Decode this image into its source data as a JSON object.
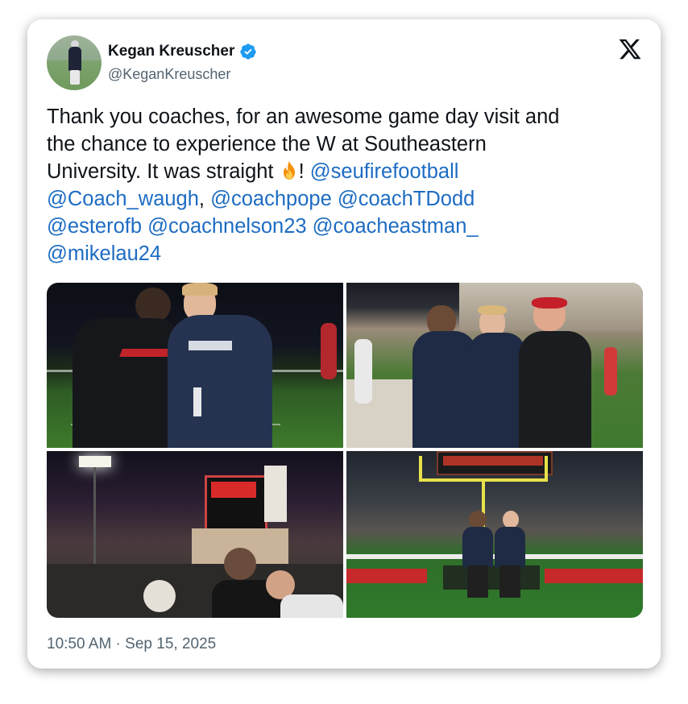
{
  "author": {
    "display_name": "Kegan Kreuscher",
    "handle": "@KeganKreuscher",
    "verified": true
  },
  "tweet": {
    "text_line_1": "Thank you coaches, for an awesome game day visit and",
    "text_line_2": "the chance to experience the W at Southeastern",
    "text_line_3": "University. It was straight ",
    "emoji": "fire",
    "exclaim": "! ",
    "mentions": {
      "m1": "@seufirefootball",
      "m2": "@Coach_waugh",
      "sep": ", ",
      "m3": "@coachpope",
      "m4": "@coachTDodd",
      "m5": "@esterofb",
      "m6": "@coachnelson23",
      "m7": "@coacheastman_",
      "m8": "@mikelau24"
    }
  },
  "media": {
    "count": 4,
    "photos": [
      "football-visit-photo-1",
      "football-visit-photo-2",
      "football-visit-photo-3",
      "football-visit-photo-4"
    ]
  },
  "timestamp": "10:50 AM · Sep 15, 2025",
  "colors": {
    "link": "#1d6cc3",
    "text": "#0f1419",
    "secondary": "#536471",
    "verified": "#1d9bf0"
  },
  "icons": [
    "verified-badge-icon",
    "x-logo-icon",
    "fire-emoji-icon"
  ]
}
